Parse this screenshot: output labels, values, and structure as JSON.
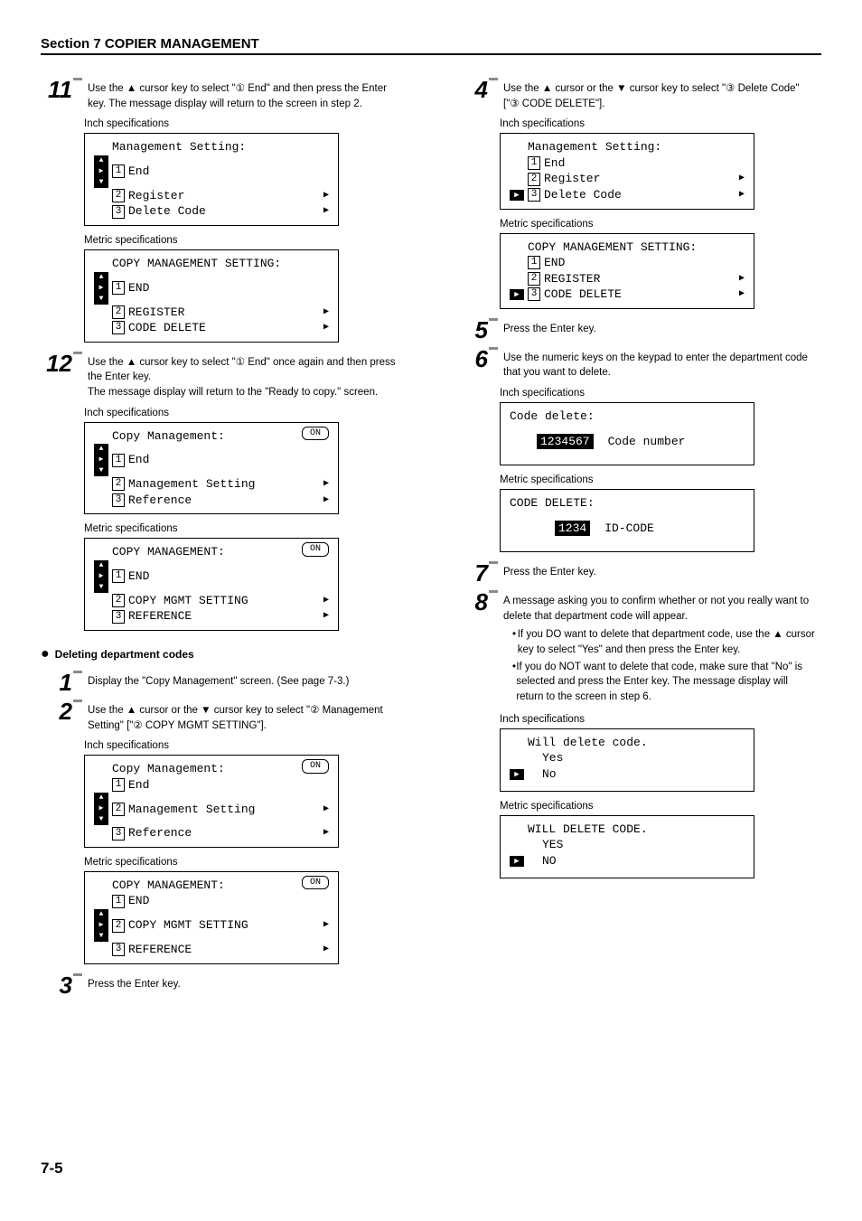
{
  "section_title": "Section 7  COPIER MANAGEMENT",
  "page_number": "7-5",
  "left": {
    "step11": {
      "num": "11",
      "text": "Use the ▲ cursor key to select \"① End\" and then press the Enter key. The message display will return to the screen in step 2.",
      "inch_label": "Inch specifications",
      "inch_lcd": {
        "title": "Management Setting:",
        "l1": "End",
        "l2": "Register",
        "l3": "Delete Code"
      },
      "metric_label": "Metric specifications",
      "metric_lcd": {
        "title": "COPY MANAGEMENT SETTING:",
        "l1": "END",
        "l2": "REGISTER",
        "l3": "CODE DELETE"
      }
    },
    "step12": {
      "num": "12",
      "text": "Use the ▲ cursor key to select \"① End\" once again and then press the Enter key.",
      "text2": "The message display will return to the \"Ready to copy.\" screen.",
      "inch_label": "Inch specifications",
      "inch_lcd": {
        "title": "Copy Management:",
        "on": "ON",
        "l1": "End",
        "l2": "Management Setting",
        "l3": "Reference"
      },
      "metric_label": "Metric specifications",
      "metric_lcd": {
        "title": "COPY MANAGEMENT:",
        "on": "ON",
        "l1": "END",
        "l2": "COPY MGMT SETTING",
        "l3": "REFERENCE"
      }
    },
    "subheading": "Deleting department codes",
    "step1": {
      "num": "1",
      "text": "Display the \"Copy Management\" screen. (See page 7-3.)"
    },
    "step2": {
      "num": "2",
      "text": "Use the ▲ cursor or the ▼ cursor key to select \"② Management Setting\" [\"② COPY MGMT SETTING\"].",
      "inch_label": "Inch specifications",
      "inch_lcd": {
        "title": "Copy Management:",
        "on": "ON",
        "l1": "End",
        "l2": "Management Setting",
        "l3": "Reference"
      },
      "metric_label": "Metric specifications",
      "metric_lcd": {
        "title": "COPY MANAGEMENT:",
        "on": "ON",
        "l1": "END",
        "l2": "COPY MGMT SETTING",
        "l3": "REFERENCE"
      }
    },
    "step3": {
      "num": "3",
      "text": "Press the Enter key."
    }
  },
  "right": {
    "step4": {
      "num": "4",
      "text": "Use the ▲ cursor or the ▼ cursor key to select \"③ Delete Code\" [\"③ CODE DELETE\"].",
      "inch_label": "Inch specifications",
      "inch_lcd": {
        "title": "Management Setting:",
        "l1": "End",
        "l2": "Register",
        "l3": "Delete Code"
      },
      "metric_label": "Metric specifications",
      "metric_lcd": {
        "title": "COPY MANAGEMENT SETTING:",
        "l1": "END",
        "l2": "REGISTER",
        "l3": "CODE DELETE"
      }
    },
    "step5": {
      "num": "5",
      "text": "Press the Enter key."
    },
    "step6": {
      "num": "6",
      "text": "Use the numeric keys on the keypad to enter the department code that you want to delete.",
      "inch_label": "Inch specifications",
      "inch_lcd": {
        "title": "Code delete:",
        "val": "1234567",
        "lbl": "Code number"
      },
      "metric_label": "Metric specifications",
      "metric_lcd": {
        "title": "CODE DELETE:",
        "val": "1234",
        "lbl": "ID-CODE"
      }
    },
    "step7": {
      "num": "7",
      "text": "Press the Enter key."
    },
    "step8": {
      "num": "8",
      "text": "A message asking you to confirm whether or not you really want to delete that department code will appear.",
      "b1": "If you DO want to delete that department code, use the ▲ cursor key to select \"Yes\" and then press the Enter key.",
      "b2": "If you do NOT want to delete that code, make sure that \"No\" is selected and press the Enter key. The message display will return to the screen in step 6.",
      "inch_label": "Inch specifications",
      "inch_lcd": {
        "title": "Will delete code.",
        "l1": "Yes",
        "l2": "No"
      },
      "metric_label": "Metric specifications",
      "metric_lcd": {
        "title": "WILL DELETE CODE.",
        "l1": "YES",
        "l2": "NO"
      }
    }
  }
}
